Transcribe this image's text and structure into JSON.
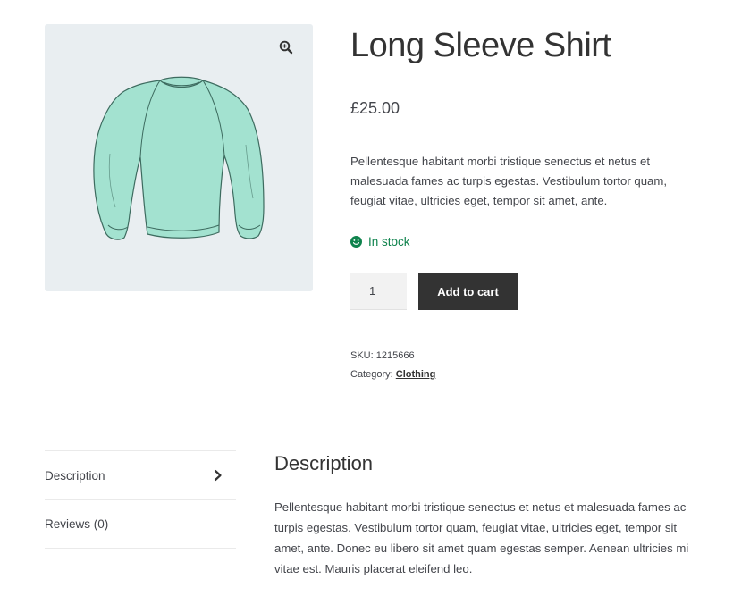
{
  "gallery": {
    "image_icon": "long-sleeve-shirt-image",
    "zoom_icon": "magnifier-plus-icon",
    "shirt_color": "#a3e2d0"
  },
  "product": {
    "title": "Long Sleeve Shirt",
    "price": "£25.00",
    "short_description": "Pellentesque habitant morbi tristique senectus et netus et malesuada fames ac turpis egestas. Vestibulum tortor quam, feugiat vitae, ultricies eget, tempor sit amet, ante.",
    "stock": {
      "label": "In stock",
      "color": "#0f834d",
      "icon": "smiley-icon"
    },
    "quantity": "1",
    "add_to_cart_label": "Add to cart",
    "sku_label": "SKU:",
    "sku_value": "1215666",
    "category_label": "Category:",
    "category_value": "Clothing"
  },
  "tabs": [
    {
      "label": "Description",
      "active": true
    },
    {
      "label": "Reviews (0)",
      "active": false
    }
  ],
  "description_panel": {
    "title": "Description",
    "text": "Pellentesque habitant morbi tristique senectus et netus et malesuada fames ac turpis egestas. Vestibulum tortor quam, feugiat vitae, ultricies eget, tempor sit amet, ante. Donec eu libero sit amet quam egestas semper. Aenean ultricies mi vitae est. Mauris placerat eleifend leo."
  },
  "colors": {
    "button": "#333333",
    "text": "#43454b",
    "gallery_bg": "#e9eef1"
  }
}
